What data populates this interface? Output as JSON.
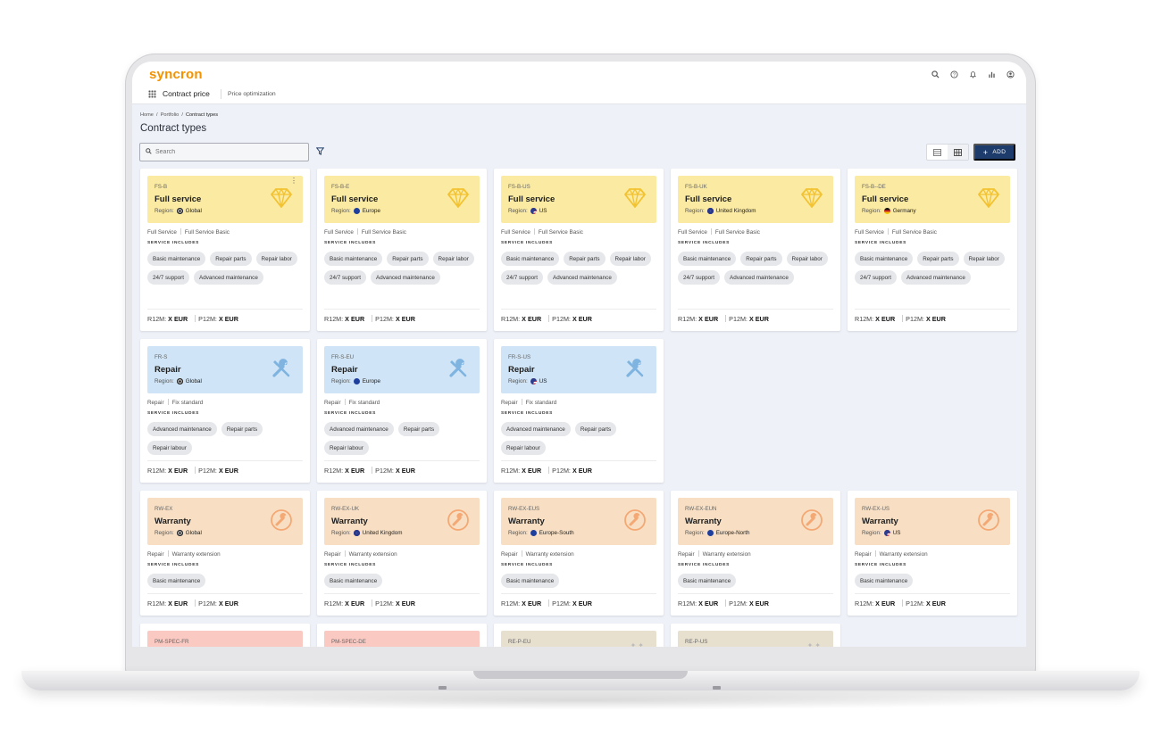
{
  "app": {
    "logo": "syncron",
    "nav_title": "Contract price",
    "nav_tab": "Price optimization"
  },
  "top_icons": [
    "search-icon",
    "help-icon",
    "bell-icon",
    "chart-icon",
    "user-icon"
  ],
  "breadcrumb": {
    "home": "Home",
    "portfolio": "Portfolio",
    "current": "Contract types",
    "separator": "/"
  },
  "page_title": "Contract types",
  "search": {
    "placeholder": "Search",
    "value": ""
  },
  "toolbar": {
    "add_label": "ADD"
  },
  "labels": {
    "region": "Region:",
    "service_includes": "SERVICE INCLUDES",
    "r12m": "R12M:",
    "p12m": "P12M:",
    "price_value": "X",
    "currency": "EUR"
  },
  "cards": [
    {
      "code": "FS-B",
      "name": "Full service",
      "region": "Global",
      "flag": "global",
      "theme": "yellow",
      "icon": "diamond-icon",
      "category": "Full Service",
      "subcategory": "Full Service Basic",
      "chips": [
        "Basic maintenance",
        "Repair parts",
        "Repair labor",
        "24/7 support",
        "Advanced maintenance"
      ],
      "menu": true
    },
    {
      "code": "FS-B-E",
      "name": "Full service",
      "region": "Europe",
      "flag": "eu",
      "theme": "yellow",
      "icon": "diamond-icon",
      "category": "Full Service",
      "subcategory": "Full Service Basic",
      "chips": [
        "Basic maintenance",
        "Repair parts",
        "Repair labor",
        "24/7 support",
        "Advanced maintenance"
      ]
    },
    {
      "code": "FS-B-US",
      "name": "Full service",
      "region": "US",
      "flag": "us",
      "theme": "yellow",
      "icon": "diamond-icon",
      "category": "Full Service",
      "subcategory": "Full Service Basic",
      "chips": [
        "Basic maintenance",
        "Repair parts",
        "Repair labor",
        "24/7 support",
        "Advanced maintenance"
      ]
    },
    {
      "code": "FS-B-UK",
      "name": "Full service",
      "region": "United Kingdom",
      "flag": "uk",
      "theme": "yellow",
      "icon": "diamond-icon",
      "category": "Full Service",
      "subcategory": "Full Service Basic",
      "chips": [
        "Basic maintenance",
        "Repair parts",
        "Repair labor",
        "24/7 support",
        "Advanced maintenance"
      ]
    },
    {
      "code": "FS-B--DE",
      "name": "Full service",
      "region": "Germany",
      "flag": "de",
      "theme": "yellow",
      "icon": "diamond-icon",
      "category": "Full Service",
      "subcategory": "Full Service Basic",
      "chips": [
        "Basic maintenance",
        "Repair parts",
        "Repair labor",
        "24/7 support",
        "Advanced maintenance"
      ]
    },
    {
      "code": "FR-S",
      "name": "Repair",
      "region": "Global",
      "flag": "global",
      "theme": "blue",
      "icon": "tools-icon",
      "category": "Repair",
      "subcategory": "Fix standard",
      "chips": [
        "Advanced maintenance",
        "Repair parts",
        "Repair labour"
      ]
    },
    {
      "code": "FR-S-EU",
      "name": "Repair",
      "region": "Europe",
      "flag": "eu",
      "theme": "blue",
      "icon": "tools-icon",
      "category": "Repair",
      "subcategory": "Fix standard",
      "chips": [
        "Advanced maintenance",
        "Repair parts",
        "Repair labour"
      ]
    },
    {
      "code": "FR-S-US",
      "name": "Repair",
      "region": "US",
      "flag": "us",
      "theme": "blue",
      "icon": "tools-icon",
      "category": "Repair",
      "subcategory": "Fix standard",
      "chips": [
        "Advanced maintenance",
        "Repair parts",
        "Repair labour"
      ]
    },
    {
      "code": "RW-EX",
      "name": "Warranty",
      "region": "Global",
      "flag": "global",
      "theme": "orange",
      "icon": "wrench-icon",
      "category": "Repair",
      "subcategory": "Warranty extension",
      "chips": [
        "Basic maintenance"
      ]
    },
    {
      "code": "RW-EX-UK",
      "name": "Warranty",
      "region": "United Kingdom",
      "flag": "uk",
      "theme": "orange",
      "icon": "wrench-icon",
      "category": "Repair",
      "subcategory": "Warranty extension",
      "chips": [
        "Basic maintenance"
      ]
    },
    {
      "code": "RW-EX-EUS",
      "name": "Warranty",
      "region": "Europe-South",
      "flag": "eu",
      "theme": "orange",
      "icon": "wrench-icon",
      "category": "Repair",
      "subcategory": "Warranty extension",
      "chips": [
        "Basic maintenance"
      ]
    },
    {
      "code": "RW-EX-EUN",
      "name": "Warranty",
      "region": "Europe-North",
      "flag": "eu",
      "theme": "orange",
      "icon": "wrench-icon",
      "category": "Repair",
      "subcategory": "Warranty extension",
      "chips": [
        "Basic maintenance"
      ]
    },
    {
      "code": "RW-EX-US",
      "name": "Warranty",
      "region": "US",
      "flag": "us",
      "theme": "orange",
      "icon": "wrench-icon",
      "category": "Repair",
      "subcategory": "Warranty extension",
      "chips": [
        "Basic maintenance"
      ]
    },
    {
      "code": "PM-SPEC-FR",
      "theme": "red",
      "partial": true
    },
    {
      "code": "PM-SPEC-DE",
      "theme": "red",
      "partial": true
    },
    {
      "code": "RE-P-EU",
      "theme": "beige",
      "partial": true
    },
    {
      "code": "RE-P-US",
      "theme": "beige",
      "partial": true
    }
  ],
  "colors": {
    "brand": "#f39200",
    "primary": "#1d3c6b",
    "full_service": "#fbeaa2",
    "repair": "#cfe4f6",
    "warranty": "#f8dfc3",
    "pm_spec": "#f9c9c2",
    "re_p": "#e8e0cf"
  }
}
